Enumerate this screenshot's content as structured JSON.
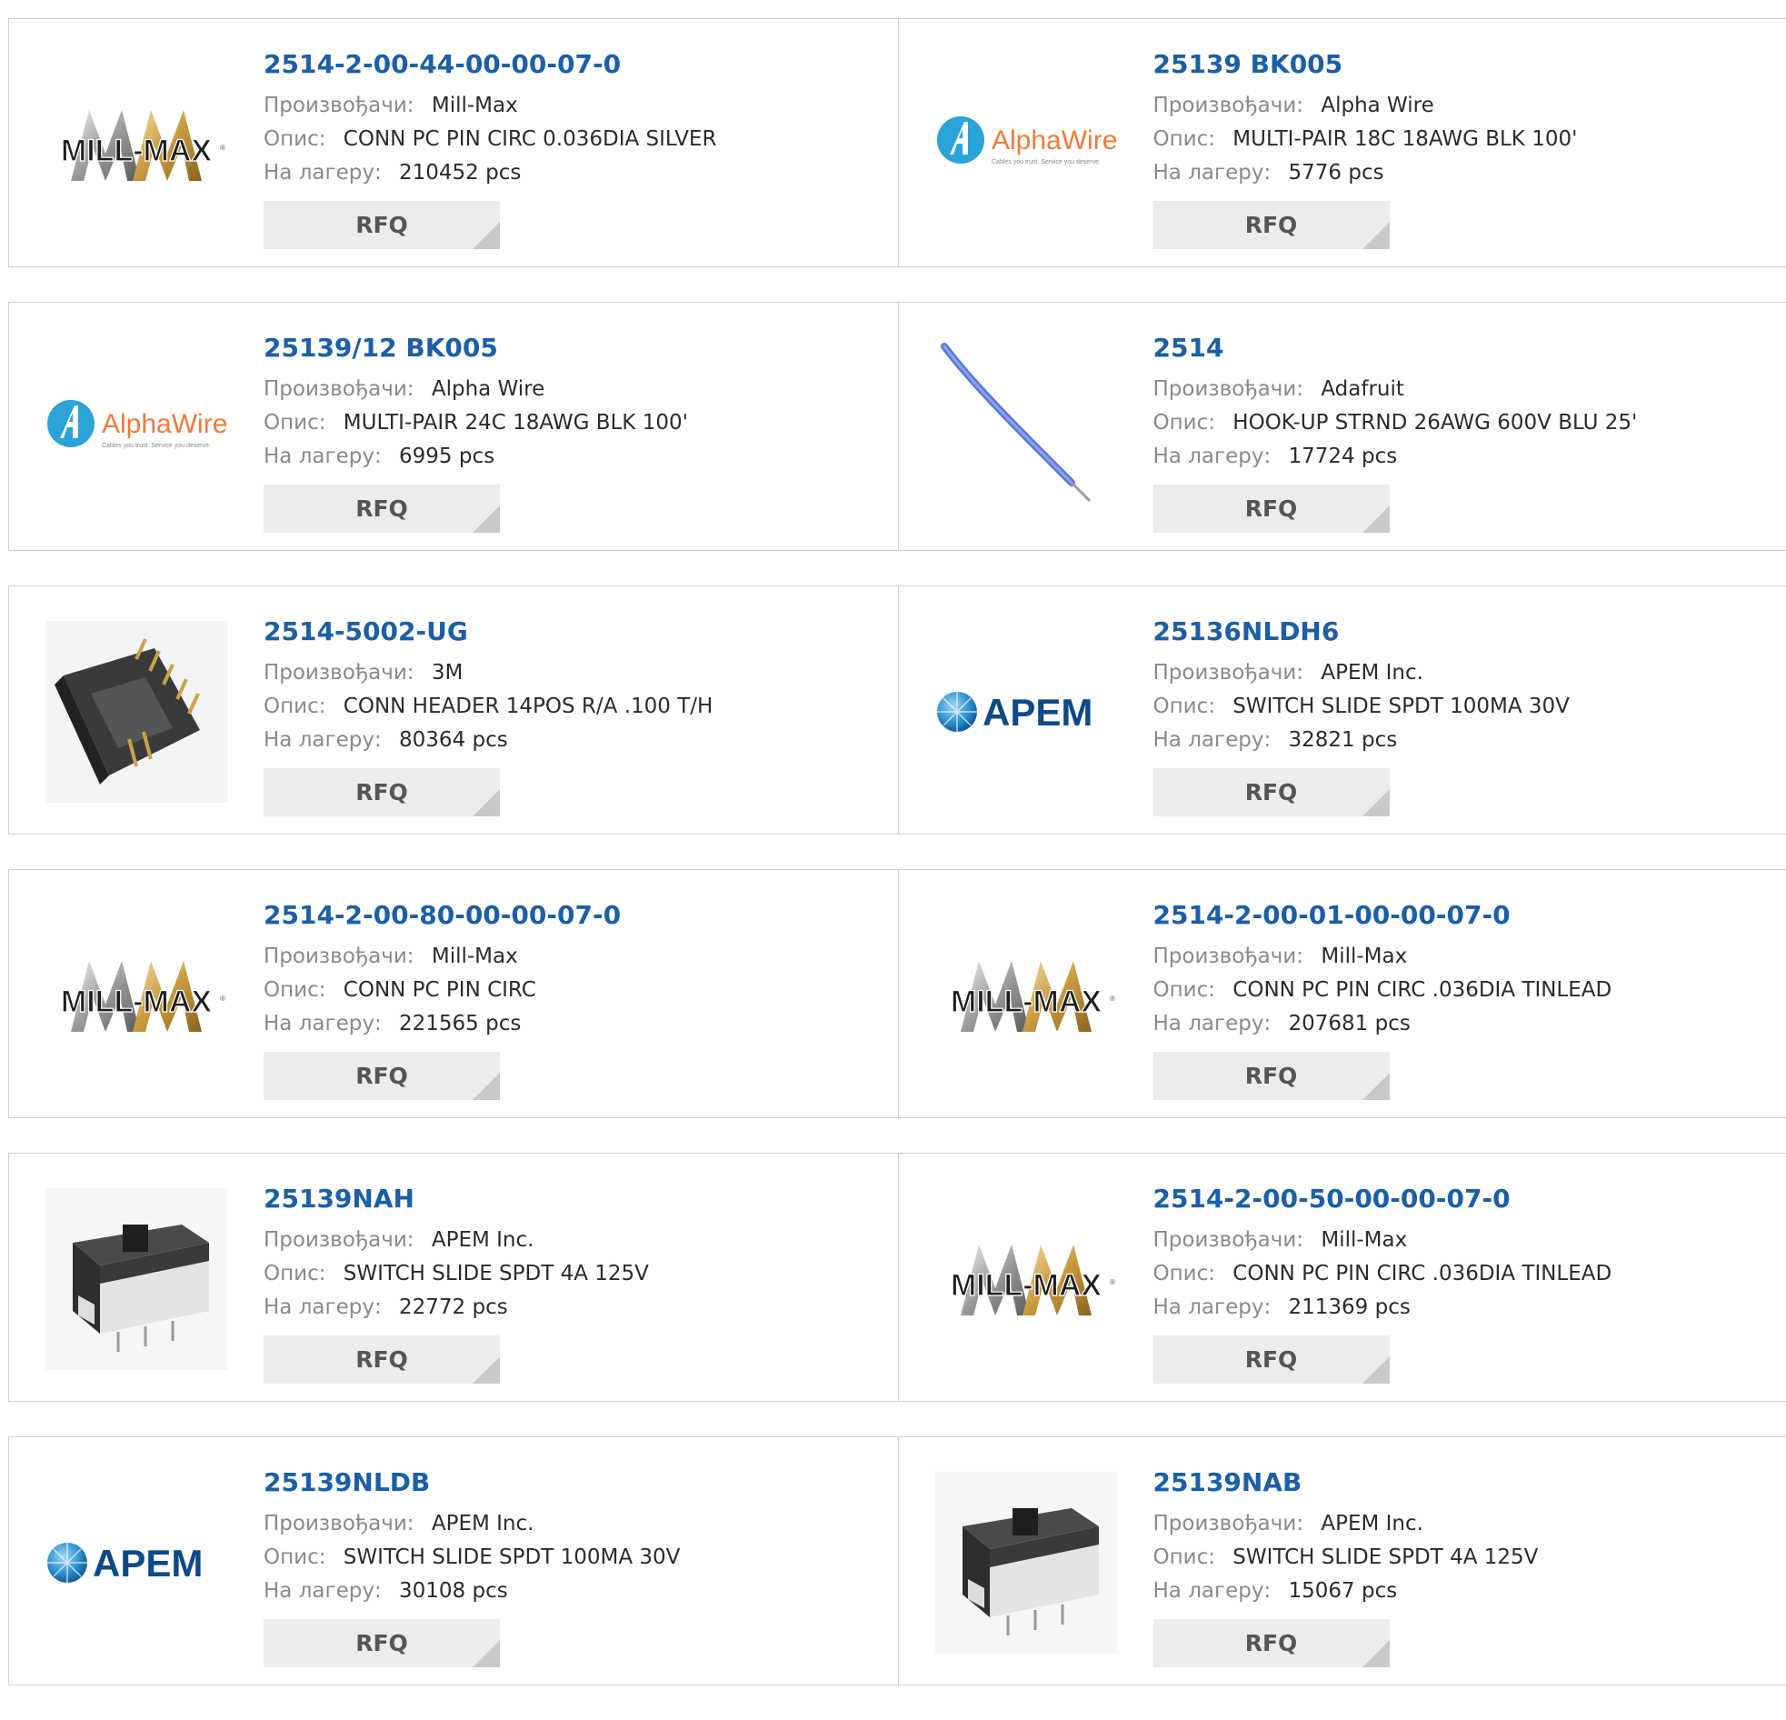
{
  "labels": {
    "manufacturer": "Произвођачи:",
    "description": "Опис:",
    "stock": "На лагеру:",
    "rfq": "RFQ"
  },
  "brand_text": {
    "millmax": "MILL-MAX",
    "alphawire": "AlphaWire",
    "alphawire_tagline": "Cables you trust. Service you deserve.",
    "apem": "APEM"
  },
  "colors": {
    "part_link": "#1a5fa8",
    "label": "#8a8a8a",
    "rfq_bg": "#ececec",
    "border": "#cfcfcf"
  },
  "products": [
    {
      "part": "2514-2-00-44-00-00-07-0",
      "manufacturer": "Mill-Max",
      "description": "CONN PC PIN CIRC 0.036DIA SILVER",
      "stock": "210452 pcs",
      "image": "millmax-logo"
    },
    {
      "part": "25139 BK005",
      "manufacturer": "Alpha Wire",
      "description": "MULTI-PAIR 18C 18AWG BLK 100'",
      "stock": "5776 pcs",
      "image": "alphawire-logo"
    },
    {
      "part": "25139/12 BK005",
      "manufacturer": "Alpha Wire",
      "description": "MULTI-PAIR 24C 18AWG BLK 100'",
      "stock": "6995 pcs",
      "image": "alphawire-logo"
    },
    {
      "part": "2514",
      "manufacturer": "Adafruit",
      "description": "HOOK-UP STRND 26AWG 600V BLU 25'",
      "stock": "17724 pcs",
      "image": "blue-wire-photo"
    },
    {
      "part": "2514-5002-UG",
      "manufacturer": "3M",
      "description": "CONN HEADER 14POS R/A .100 T/H",
      "stock": "80364 pcs",
      "image": "header-connector-photo"
    },
    {
      "part": "25136NLDH6",
      "manufacturer": "APEM Inc.",
      "description": "SWITCH SLIDE SPDT 100MA 30V",
      "stock": "32821 pcs",
      "image": "apem-logo"
    },
    {
      "part": "2514-2-00-80-00-00-07-0",
      "manufacturer": "Mill-Max",
      "description": "CONN PC PIN CIRC",
      "stock": "221565 pcs",
      "image": "millmax-logo"
    },
    {
      "part": "2514-2-00-01-00-00-07-0",
      "manufacturer": "Mill-Max",
      "description": "CONN PC PIN CIRC .036DIA TINLEAD",
      "stock": "207681 pcs",
      "image": "millmax-logo"
    },
    {
      "part": "25139NAH",
      "manufacturer": "APEM Inc.",
      "description": "SWITCH SLIDE SPDT 4A 125V",
      "stock": "22772 pcs",
      "image": "slide-switch-photo"
    },
    {
      "part": "2514-2-00-50-00-00-07-0",
      "manufacturer": "Mill-Max",
      "description": "CONN PC PIN CIRC .036DIA TINLEAD",
      "stock": "211369 pcs",
      "image": "millmax-logo"
    },
    {
      "part": "25139NLDB",
      "manufacturer": "APEM Inc.",
      "description": "SWITCH SLIDE SPDT 100MA 30V",
      "stock": "30108 pcs",
      "image": "apem-logo"
    },
    {
      "part": "25139NAB",
      "manufacturer": "APEM Inc.",
      "description": "SWITCH SLIDE SPDT 4A 125V",
      "stock": "15067 pcs",
      "image": "slide-switch-photo"
    }
  ]
}
